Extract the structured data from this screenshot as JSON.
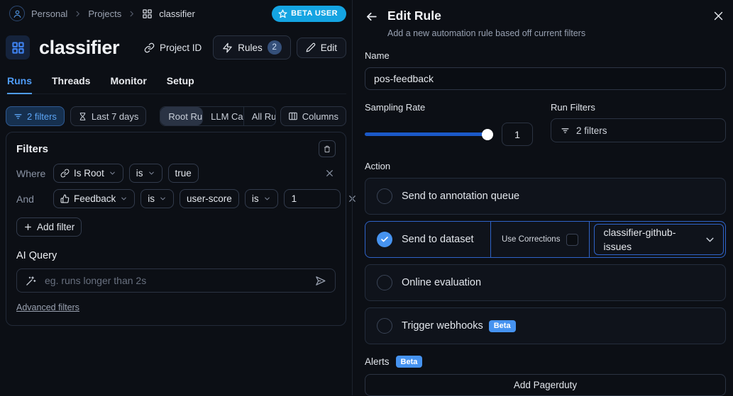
{
  "breadcrumb": {
    "items": [
      "Personal",
      "Projects",
      "classifier"
    ]
  },
  "beta_user_badge": "BETA USER",
  "project": {
    "title": "classifier",
    "project_id_label": "Project ID",
    "rules_label": "Rules",
    "rules_count": "2",
    "edit_label": "Edit"
  },
  "tabs": [
    {
      "label": "Runs",
      "active": true
    },
    {
      "label": "Threads",
      "active": false
    },
    {
      "label": "Monitor",
      "active": false
    },
    {
      "label": "Setup",
      "active": false
    }
  ],
  "filter_bar": {
    "filters_button": "2 filters",
    "date_button": "Last 7 days",
    "segments": [
      "Root Runs",
      "LLM Calls",
      "All Runs"
    ],
    "columns_button": "Columns"
  },
  "filters_panel": {
    "title": "Filters",
    "row1": {
      "conjunction": "Where",
      "field": "Is Root",
      "op": "is",
      "value": "true"
    },
    "row2": {
      "conjunction": "And",
      "field": "Feedback",
      "op1": "is",
      "key": "user-score",
      "op2": "is",
      "value": "1"
    },
    "add_filter_label": "Add filter",
    "ai_query": {
      "label": "AI Query",
      "placeholder": "eg. runs longer than 2s"
    },
    "advanced_link": "Advanced filters"
  },
  "panel": {
    "title": "Edit Rule",
    "subtitle": "Add a new automation rule based off current filters",
    "name": {
      "label": "Name",
      "value": "pos-feedback"
    },
    "sampling": {
      "label": "Sampling Rate",
      "value": "1"
    },
    "run_filters": {
      "label": "Run Filters",
      "value": "2 filters"
    },
    "action": {
      "label": "Action",
      "options": [
        {
          "label": "Send to annotation queue",
          "selected": false
        },
        {
          "label": "Send to dataset",
          "selected": true,
          "use_corrections_label": "Use Corrections",
          "use_corrections_checked": false,
          "dataset": "classifier-github-issues"
        },
        {
          "label": "Online evaluation",
          "selected": false
        },
        {
          "label": "Trigger webhooks",
          "selected": false,
          "badge": "Beta"
        }
      ]
    },
    "alerts": {
      "label": "Alerts",
      "badge": "Beta",
      "button": "Add Pagerduty"
    }
  },
  "colors": {
    "background": "#0c0f15",
    "accent_blue": "#4693f0",
    "active_tab_blue": "#4f9cf8",
    "beta_user_pill": "#14a4e2",
    "slider_fill": "#1b59c8",
    "selected_row_border": "#2f63c8",
    "filters_button_bg": "#16304f"
  }
}
